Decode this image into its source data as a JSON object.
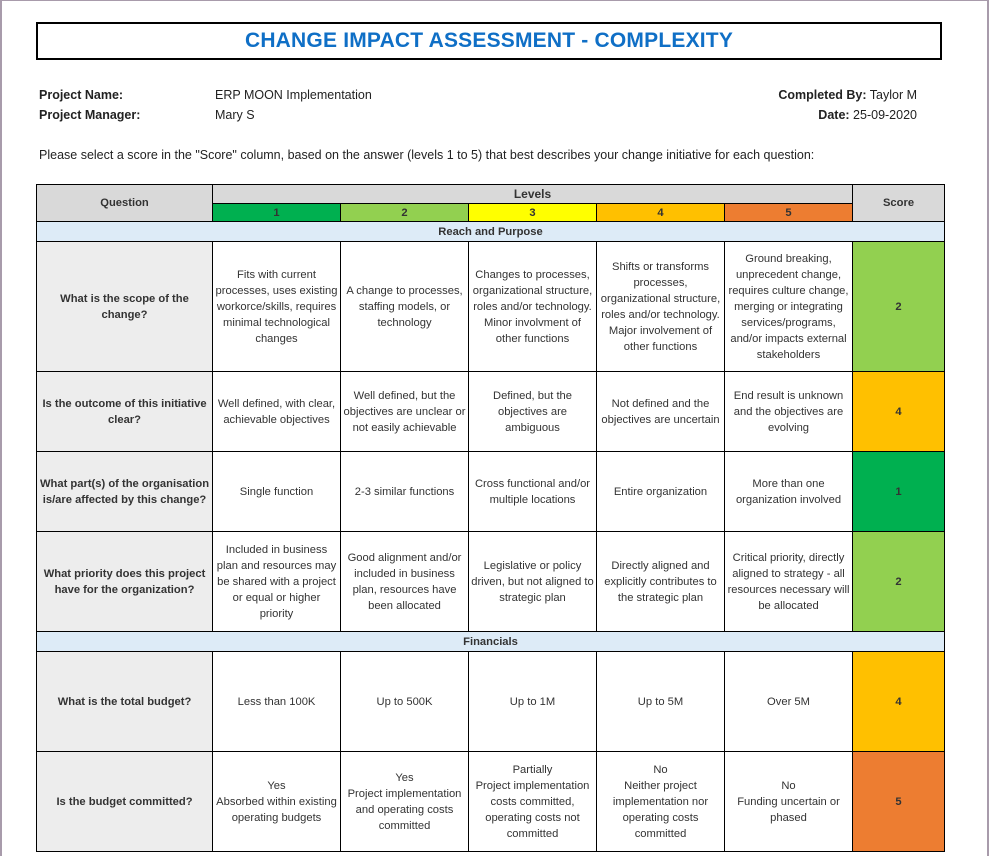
{
  "title": "CHANGE IMPACT ASSESSMENT - COMPLEXITY",
  "project": {
    "name_label": "Project Name:",
    "name_value": "ERP MOON Implementation",
    "manager_label": "Project Manager:",
    "manager_value": "Mary S",
    "completed_by_label": "Completed By:",
    "completed_by_value": "Taylor M",
    "date_label": "Date:",
    "date_value": "25-09-2020"
  },
  "instructions": "Please select a score in the \"Score\" column, based on the answer (levels 1 to 5) that best describes your change initiative for each question:",
  "table": {
    "question_header": "Question",
    "levels_header": "Levels",
    "score_header": "Score",
    "levels": [
      {
        "label": "1",
        "color": "#00b050"
      },
      {
        "label": "2",
        "color": "#92d050"
      },
      {
        "label": "3",
        "color": "#ffff00"
      },
      {
        "label": "4",
        "color": "#ffc000"
      },
      {
        "label": "5",
        "color": "#ed7d31"
      }
    ],
    "sections": [
      {
        "title": "Reach and Purpose",
        "rows": [
          {
            "question": "What is the scope of the change?",
            "answers": [
              "Fits with current processes, uses existing workorce/skills, requires minimal technological changes",
              "A change to processes, staffing models, or technology",
              "Changes to processes, organizational structure, roles and/or technology. Minor involvment of other functions",
              "Shifts or transforms processes, organizational structure, roles and/or technology. Major involvement of other functions",
              "Ground breaking, unprecedent change, requires culture change, merging or integrating services/programs, and/or impacts external stakeholders"
            ],
            "score": "2"
          },
          {
            "question": "Is the outcome of this initiative clear?",
            "answers": [
              "Well defined, with clear, achievable objectives",
              "Well defined, but the objectives are unclear or not easily achievable",
              "Defined, but the objectives are ambiguous",
              "Not defined and the objectives are uncertain",
              "End result is unknown and the objectives are evolving"
            ],
            "score": "4"
          },
          {
            "question": "What part(s) of the organisation is/are affected by this change?",
            "answers": [
              "Single function",
              "2-3 similar functions",
              "Cross functional and/or multiple locations",
              "Entire organization",
              "More than one organization involved"
            ],
            "score": "1"
          },
          {
            "question": "What priority does this project have for the organization?",
            "answers": [
              "Included in business plan and resources may be shared with a project or equal or higher priority",
              "Good alignment and/or included in business plan, resources have been allocated",
              "Legislative or policy driven, but not aligned to strategic plan",
              "Directly aligned and explicitly contributes to the strategic plan",
              "Critical priority, directly aligned to strategy - all resources necessary will be allocated"
            ],
            "score": "2"
          }
        ]
      },
      {
        "title": "Financials",
        "rows": [
          {
            "question": "What is the total budget?",
            "answers": [
              "Less than 100K",
              "Up to 500K",
              "Up to 1M",
              "Up to 5M",
              "Over 5M"
            ],
            "score": "4"
          },
          {
            "question": "Is the budget committed?",
            "answers": [
              "Yes\nAbsorbed within existing operating budgets",
              "Yes\nProject implementation and operating costs committed",
              "Partially\nProject implementation costs committed, operating costs not committed",
              "No\nNeither project implementation nor operating costs committed",
              "No\nFunding uncertain or phased"
            ],
            "score": "5"
          }
        ]
      }
    ]
  }
}
